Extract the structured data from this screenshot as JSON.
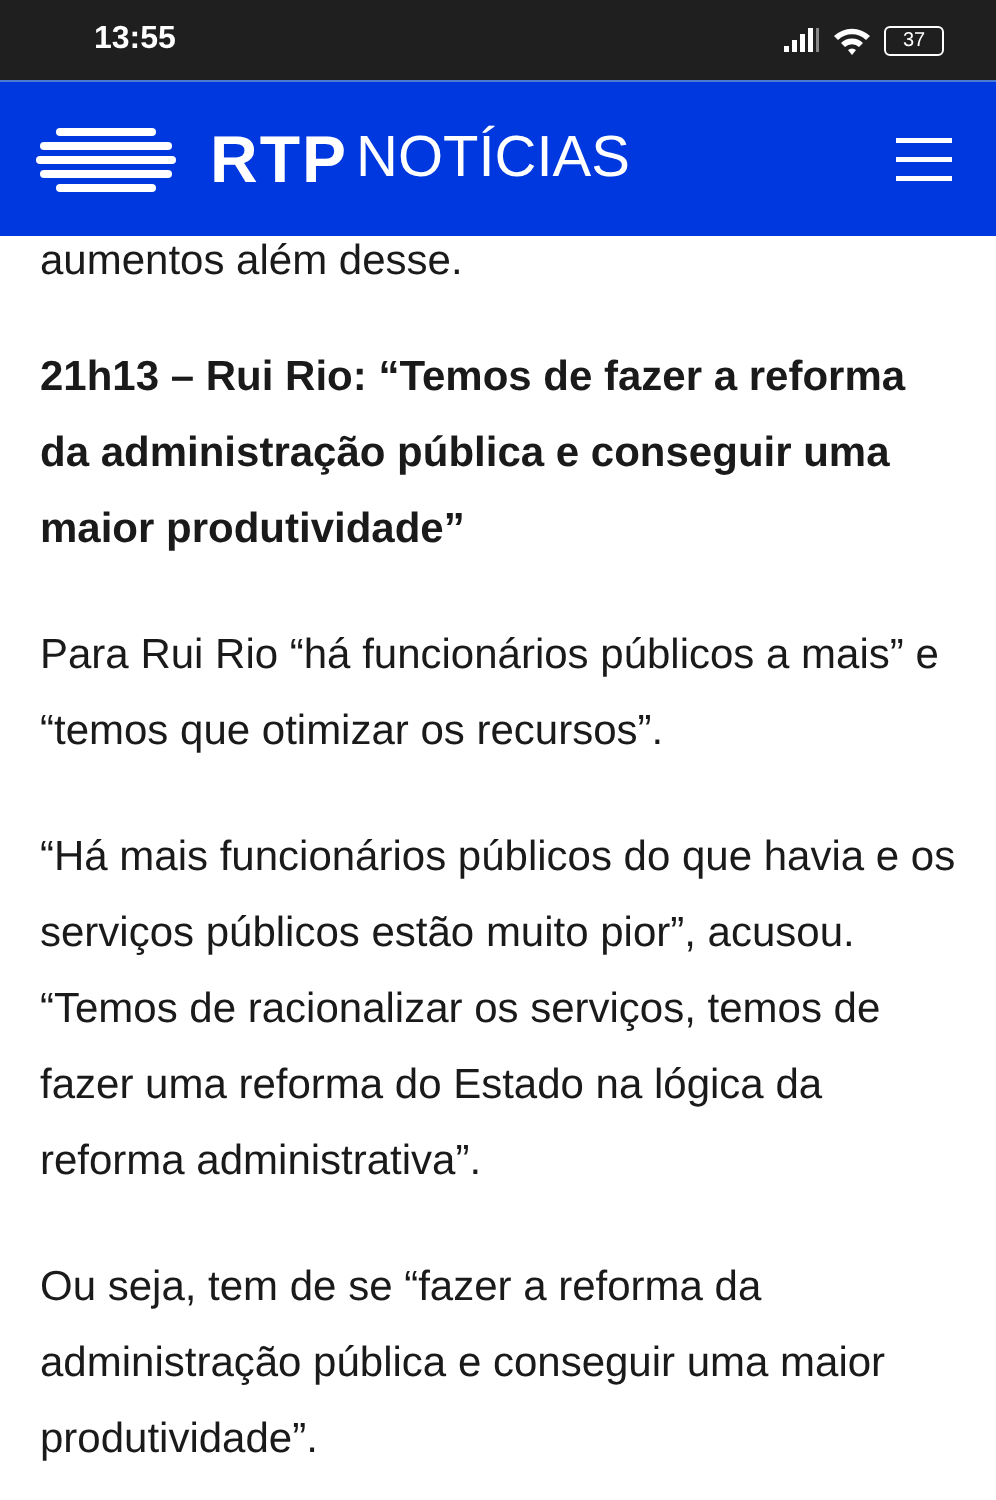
{
  "status_bar": {
    "time": "13:55",
    "battery": "37"
  },
  "header": {
    "brand": "RTP",
    "section": "NOTÍCIAS"
  },
  "article": [
    {
      "kind": "paragraph",
      "text": "aumentos além desse."
    },
    {
      "kind": "heading",
      "text": "21h13 – Rui Rio: “Temos de fazer a reforma da administração pública e conseguir uma maior produtividade”"
    },
    {
      "kind": "paragraph",
      "text": "Para Rui Rio “há funcionários públicos a mais” e “temos que otimizar os recursos”."
    },
    {
      "kind": "paragraph",
      "text": "“Há mais funcionários públicos do que havia e os serviços públicos estão muito pior”, acusou. “Temos de racionalizar os serviços, temos de fazer uma reforma do Estado na lógica da reforma administrativa”."
    },
    {
      "kind": "paragraph",
      "text": "Ou seja, tem de se “fazer a reforma da administração pública e conseguir uma maior produtividade”."
    }
  ]
}
